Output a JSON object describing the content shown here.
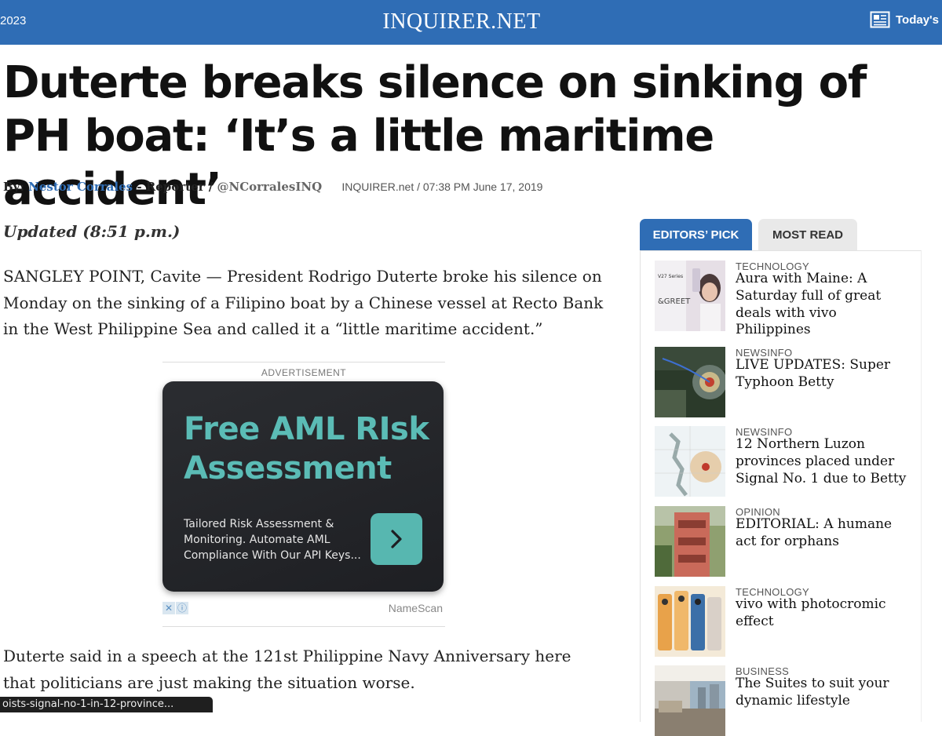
{
  "header": {
    "date_fragment": "2023",
    "brand": "INQUIRER.NET",
    "today_label": "Today's P"
  },
  "article": {
    "headline": "Duterte breaks silence on sinking of PH boat: ‘It’s a little maritime accident’",
    "byline": {
      "prefix": "By:",
      "author": "Nestor Corrales",
      "role": "- Reporter /",
      "handle": "@NCorralesINQ",
      "source_time": "INQUIRER.net / 07:38 PM June 17, 2019"
    },
    "updated": "Updated (8:51 p.m.)",
    "paragraph_1": "SANGLEY POINT, Cavite — President Rodrigo Duterte broke his silence on Monday on the sinking of a Filipino boat by a Chinese vessel at Recto Bank in the West Philippine Sea and called it a “little maritime accident.”",
    "paragraph_2": "Duterte said in a speech at the 121st Philippine Navy Anniversary here that politicians are just making the situation worse."
  },
  "advertisement": {
    "label": "ADVERTISEMENT",
    "headline": "Free AML RIsk Assessment",
    "body": "Tailored Risk Assessment & Monitoring. Automate AML Compliance With Our API Keys...",
    "sponsor": "NameScan",
    "accent_color": "#57b7b0"
  },
  "sidebar": {
    "tabs": [
      {
        "label": "EDITORS’ PICK",
        "active": true
      },
      {
        "label": "MOST READ",
        "active": false
      }
    ],
    "items": [
      {
        "category": "TECHNOLOGY",
        "title": "Aura with Maine: A Saturday full of great deals with vivo Philippines",
        "thumb": "vivo-promo-thumbnail"
      },
      {
        "category": "NEWSINFO",
        "title": "LIVE UPDATES: Super Typhoon Betty",
        "thumb": "typhoon-satellite-thumbnail"
      },
      {
        "category": "NEWSINFO",
        "title": "12 Northern Luzon provinces placed under Signal No. 1 due to Betty",
        "thumb": "storm-track-map-thumbnail"
      },
      {
        "category": "OPINION",
        "title": "EDITORIAL: A humane act for orphans",
        "thumb": "orphanage-building-thumbnail"
      },
      {
        "category": "TECHNOLOGY",
        "title": "vivo with photocromic effect",
        "thumb": "vivo-phones-thumbnail"
      },
      {
        "category": "BUSINESS",
        "title": "The Suites to suit your dynamic lifestyle",
        "thumb": "condo-interior-thumbnail"
      }
    ]
  },
  "status_bar": {
    "url": "oists-signal-no-1-in-12-province..."
  },
  "colors": {
    "brand_blue": "#2f6db5",
    "text": "#222222"
  }
}
